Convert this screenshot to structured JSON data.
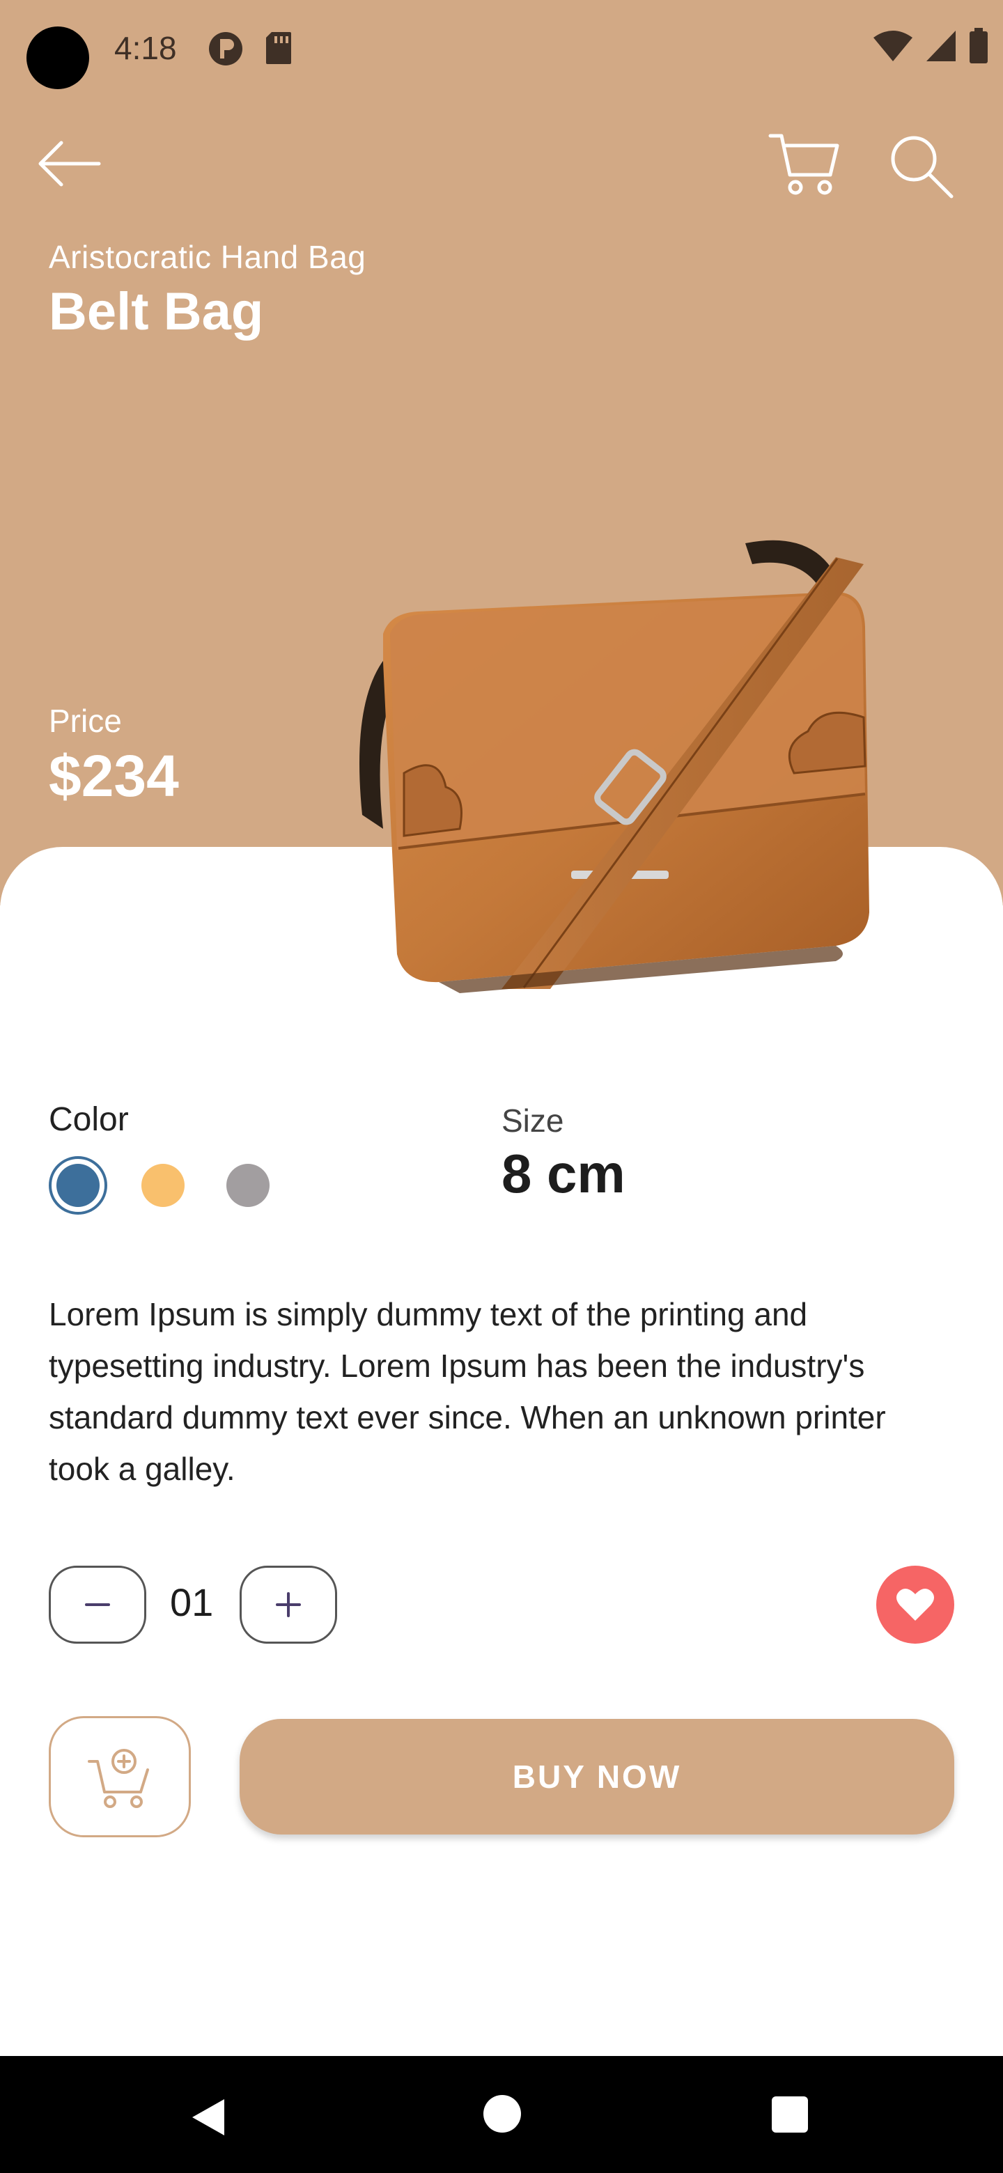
{
  "status_bar": {
    "time": "4:18",
    "icons_left": [
      "p-icon",
      "sd-card-icon"
    ],
    "icons_right": [
      "wifi-icon",
      "signal-icon",
      "battery-icon"
    ]
  },
  "app_bar": {
    "back_icon": "arrow-left-icon",
    "cart_icon": "cart-icon",
    "search_icon": "search-icon"
  },
  "product": {
    "subtitle": "Aristocratic Hand Bag",
    "title": "Belt Bag",
    "price_label": "Price",
    "price": "$234",
    "image": "brown-leather-shoulder-bag"
  },
  "options": {
    "color_label": "Color",
    "colors": [
      {
        "name": "blue",
        "hex": "#3D6F9B",
        "selected": true
      },
      {
        "name": "yellow",
        "hex": "#F9C06D",
        "selected": false
      },
      {
        "name": "grey",
        "hex": "#A29EA0",
        "selected": false
      }
    ],
    "size_label": "Size",
    "size_value": "8 cm"
  },
  "description": "Lorem Ipsum is simply dummy text of the printing and typesetting industry. Lorem Ipsum has been the industry's standard dummy text ever since. When an unknown printer took a galley.",
  "quantity": {
    "value": "01",
    "minus_icon": "minus-icon",
    "plus_icon": "plus-icon"
  },
  "favorite": {
    "icon": "heart-icon",
    "color": "#F66565"
  },
  "actions": {
    "add_to_cart_icon": "cart-add-icon",
    "buy_label": "BUY  NOW"
  },
  "theme": {
    "accent": "#D2A985",
    "text_dark": "#1d1d1d"
  },
  "nav_bar": {
    "icons": [
      "nav-back-icon",
      "nav-home-icon",
      "nav-recents-icon"
    ]
  }
}
